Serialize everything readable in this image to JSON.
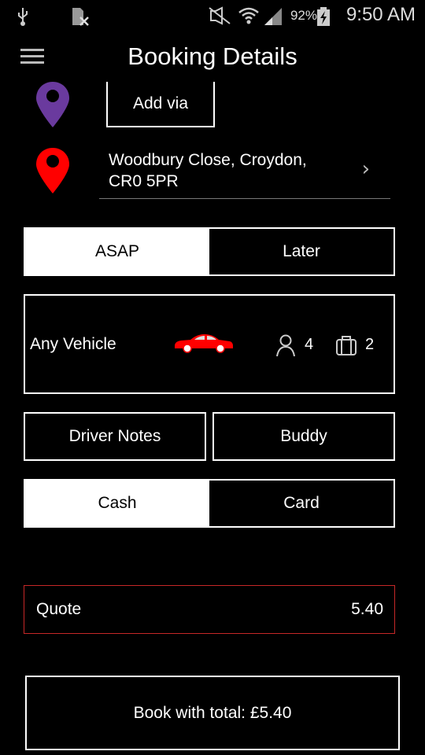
{
  "status_bar": {
    "battery": "92%",
    "time": "9:50 AM",
    "icons": [
      "usb-icon",
      "sim-missing-icon",
      "mute-icon",
      "wifi-icon",
      "signal-icon",
      "battery-charging-icon"
    ]
  },
  "header": {
    "title": "Booking Details",
    "menu_icon": "hamburger-menu-icon"
  },
  "route": {
    "via": {
      "pin_color": "#6a3a9e",
      "button_label": "Add via"
    },
    "destination": {
      "pin_color": "#ff0000",
      "address": "Woodbury Close, Croydon, CR0 5PR"
    }
  },
  "timing": {
    "options": [
      "ASAP",
      "Later"
    ],
    "selected": "ASAP"
  },
  "vehicle": {
    "name": "Any Vehicle",
    "car_color": "#ff0000",
    "passengers": "4",
    "luggage": "2"
  },
  "extras": {
    "driver_notes_label": "Driver Notes",
    "buddy_label": "Buddy"
  },
  "payment": {
    "options": [
      "Cash",
      "Card"
    ],
    "selected": "Cash"
  },
  "quote": {
    "label": "Quote",
    "value": "5.40",
    "border_color": "#c62828"
  },
  "book_button": {
    "label": "Book with total: £5.40"
  }
}
